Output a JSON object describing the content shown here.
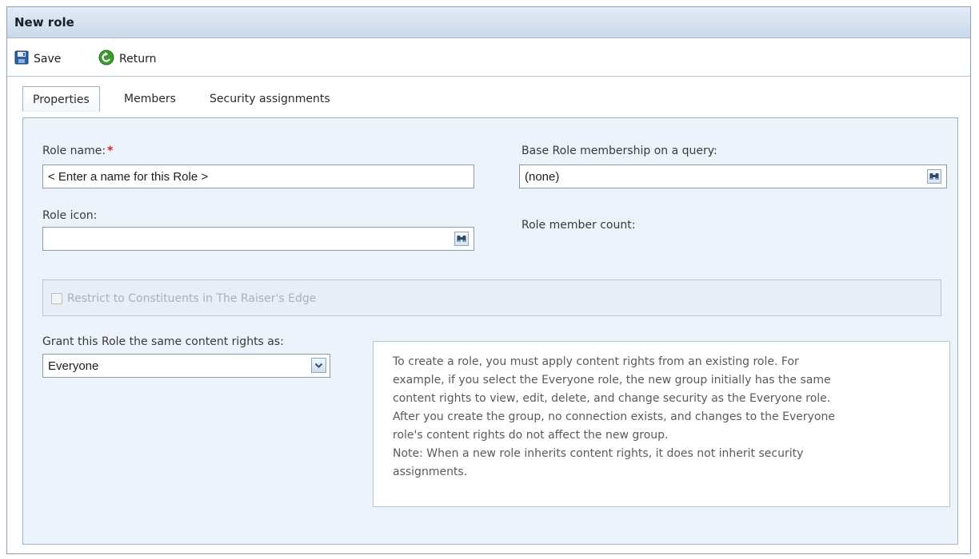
{
  "window": {
    "title": "New role"
  },
  "toolbar": {
    "save_label": "Save",
    "return_label": "Return"
  },
  "tabs": [
    {
      "label": "Properties",
      "active": true
    },
    {
      "label": "Members",
      "active": false
    },
    {
      "label": "Security assignments",
      "active": false
    }
  ],
  "form": {
    "role_name": {
      "label": "Role name:",
      "required_marker": "*",
      "value": "< Enter a name for this Role >"
    },
    "role_icon": {
      "label": "Role icon:",
      "value": ""
    },
    "base_query": {
      "label": "Base Role membership on a query:",
      "value": "(none)"
    },
    "member_count": {
      "label": "Role member count:"
    },
    "restrict": {
      "label": "Restrict to Constituents in The Raiser's Edge",
      "checked": false,
      "enabled": false
    },
    "grant": {
      "label": "Grant this Role the same content rights as:",
      "selected": "Everyone"
    }
  },
  "help_text": "To create a role, you must apply content rights from an existing role. For\nexample, if you select the Everyone role, the new group initially has the same\ncontent rights to view, edit, delete, and change security as the Everyone role.\nAfter you create the group, no connection exists, and changes to the Everyone\nrole's content rights do not affect the new group.\nNote: When a new role inherits content rights, it does not inherit security\nassignments.",
  "icons": {
    "save": "save-icon",
    "return": "return-icon",
    "search": "binoculars-icon",
    "dropdown": "chevron-down-icon"
  },
  "colors": {
    "titlebar": "#c9d8ea",
    "panel": "#edf3fa",
    "required": "#d12020",
    "return_green": "#3a9a2e",
    "save_blue": "#2c5fa8"
  }
}
